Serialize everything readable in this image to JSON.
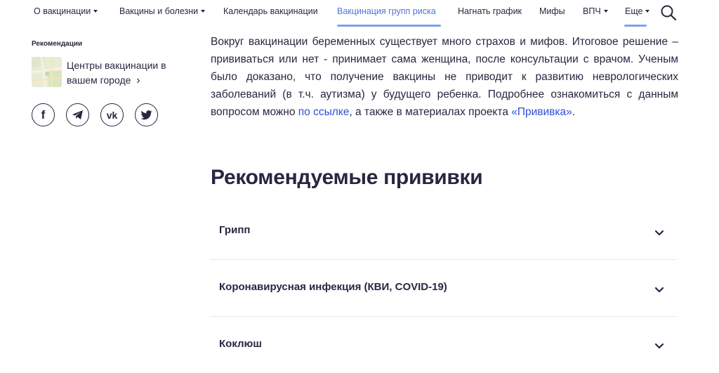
{
  "nav": {
    "items": [
      {
        "label": "О вакцинации",
        "dropdown": true
      },
      {
        "label": "Вакцины и болезни",
        "dropdown": true
      },
      {
        "label": "Календарь вакцинации",
        "dropdown": false
      },
      {
        "label": "Вакцинация групп риска",
        "dropdown": false,
        "active": true
      },
      {
        "label": "Нагнать график",
        "dropdown": false
      },
      {
        "label": "Мифы",
        "dropdown": false
      },
      {
        "label": "ВПЧ",
        "dropdown": true
      },
      {
        "label": "Еще",
        "dropdown": true
      }
    ],
    "search_icon": "search-icon"
  },
  "sidebar": {
    "title": "Рекомендации",
    "vaccination_centers": {
      "label": "Центры вакцинации в вашем городе",
      "arrow": "›"
    },
    "social": [
      {
        "name": "facebook",
        "glyph": "f"
      },
      {
        "name": "telegram",
        "glyph": ""
      },
      {
        "name": "vk",
        "glyph": "vk"
      },
      {
        "name": "twitter",
        "glyph": ""
      }
    ]
  },
  "main": {
    "paragraph": {
      "text_before_link": "Вокруг вакцинации беременных существует много страхов и мифов. Итоговое решение – прививаться или нет - принимает сама женщина, после консультации с врачом. Ученым было доказано, что получение вакцины не приводит к развитию неврологических заболеваний (в т.ч. аутизма) у будущего ребенка. Подробнее ознакомиться с данным вопросом можно ",
      "link1": "по ссылке",
      "text_between": ", а также в материалах проекта ",
      "link2": "«Прививка»",
      "text_after": "."
    },
    "heading": "Рекомендуемые прививки",
    "accordion": [
      {
        "label": "Грипп"
      },
      {
        "label": "Коронавирусная инфекция (КВИ, COVID-19)"
      },
      {
        "label": "Коклюш"
      }
    ]
  },
  "colors": {
    "text": "#2b2540",
    "accent": "#4f74d9",
    "link": "#2f4fd6"
  }
}
